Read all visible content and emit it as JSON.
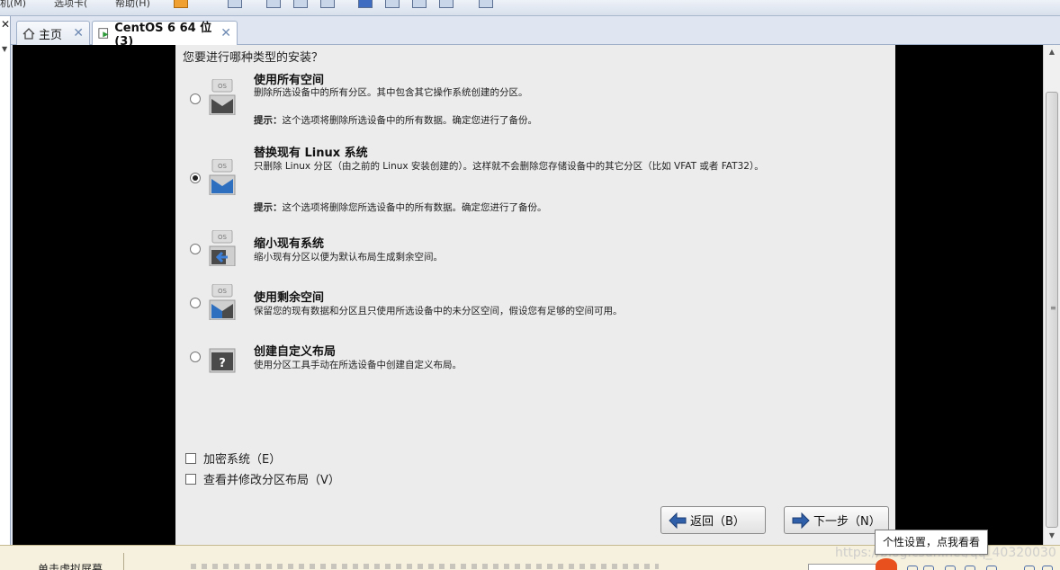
{
  "toolbar": {
    "fragments": [
      "机(M)",
      "选项卡(",
      "帮助(H)"
    ]
  },
  "tabs": [
    {
      "label": "主页",
      "icon": "home-icon",
      "active": false
    },
    {
      "label": "CentOS 6 64 位 (3)",
      "icon": "vm-icon",
      "active": true
    }
  ],
  "installer": {
    "question": "您要进行哪种类型的安装？",
    "selected_index": 1,
    "options": [
      {
        "title": "使用所有空间",
        "description": "删除所选设备中的所有分区。其中包含其它操作系统创建的分区。",
        "tip_label": "提示：",
        "tip": "这个选项将删除所选设备中的所有数据。确定您进行了备份。",
        "icon": "os-disk-wipe-icon"
      },
      {
        "title": "替换现有 Linux 系统",
        "description": "只删除 Linux 分区（由之前的 Linux 安装创建的）。这样就不会删除您存储设备中的其它分区（比如 VFAT 或者 FAT32）。",
        "tip_label": "提示：",
        "tip": "这个选项将删除您所选设备中的所有数据。确定您进行了备份。",
        "icon": "os-disk-replace-icon"
      },
      {
        "title": "缩小现有系统",
        "description": "缩小现有分区以便为默认布局生成剩余空间。",
        "icon": "os-disk-shrink-icon"
      },
      {
        "title": "使用剩余空间",
        "description": "保留您的现有数据和分区且只使用所选设备中的未分区空间，假设您有足够的空间可用。",
        "icon": "os-disk-free-space-icon"
      },
      {
        "title": "创建自定义布局",
        "description": "使用分区工具手动在所选设备中创建自定义布局。",
        "icon": "custom-layout-question-icon"
      }
    ],
    "os_label": "OS",
    "checkboxes": [
      {
        "label": "加密系统（E）",
        "checked": false
      },
      {
        "label": "查看并修改分区布局（V）",
        "checked": false
      }
    ],
    "back_label": "返回（B）",
    "next_label": "下一步（N）"
  },
  "bottom": {
    "hint": "单击虚拟屏幕"
  },
  "watermark": "https://blog.csdn.net/qq_40320030",
  "tooltip": "个性设置，点我看看"
}
